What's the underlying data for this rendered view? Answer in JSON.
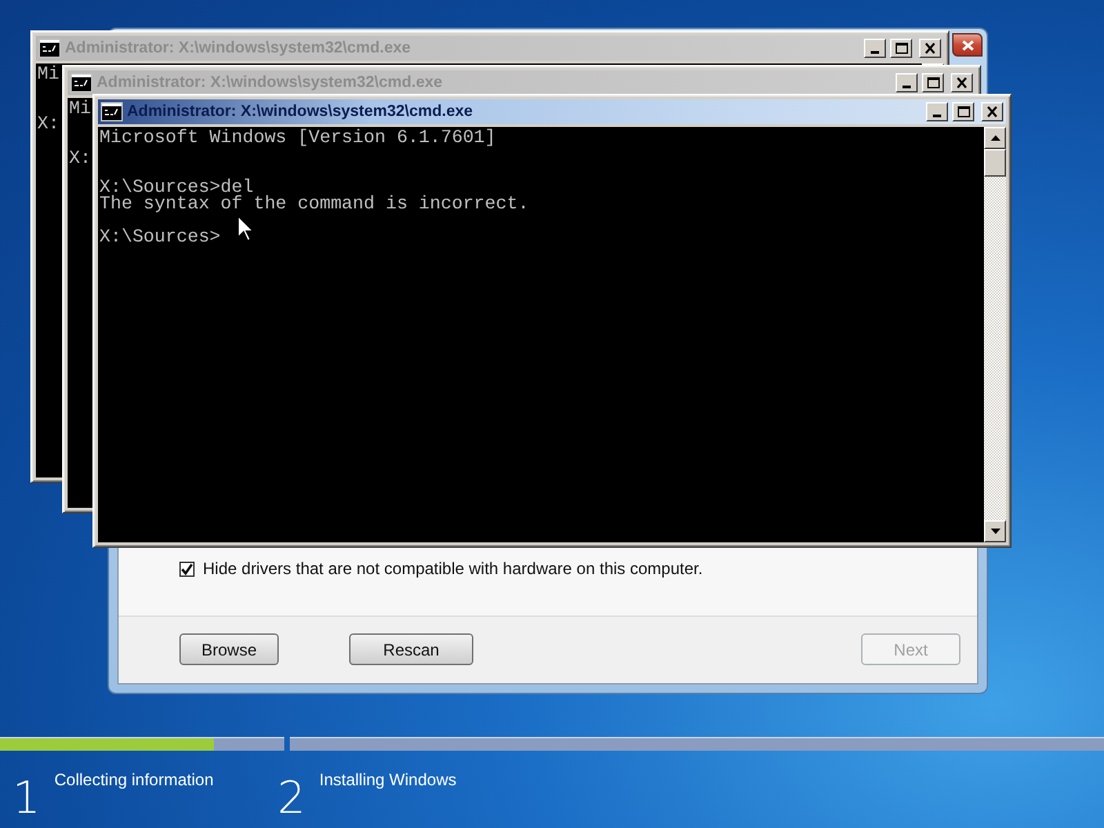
{
  "setup_dialog": {
    "checkbox": {
      "label": "Hide drivers that are not compatible with hardware on this computer.",
      "checked": true
    },
    "buttons": [
      {
        "label": "Browse",
        "disabled": false
      },
      {
        "label": "Rescan",
        "disabled": false
      },
      {
        "label": "Next",
        "disabled": true
      }
    ]
  },
  "cmd_windows": [
    {
      "title": "Administrator: X:\\windows\\system32\\cmd.exe",
      "active": false,
      "blocks": [
        [
          "Mi"
        ],
        [
          "X:"
        ]
      ]
    },
    {
      "title": "Administrator: X:\\windows\\system32\\cmd.exe",
      "active": false,
      "blocks": [
        [
          "Mi"
        ],
        [
          "X:"
        ]
      ]
    },
    {
      "title": "Administrator: X:\\windows\\system32\\cmd.exe",
      "active": true,
      "blocks": [
        [
          "Microsoft Windows [Version 6.1.7601]"
        ],
        [
          "X:\\Sources>del",
          "The syntax of the command is incorrect."
        ],
        [
          "X:\\Sources>"
        ]
      ]
    }
  ],
  "progress": {
    "steps": [
      {
        "number": "1",
        "label": "Collecting information",
        "level": 0.75
      },
      {
        "number": "2",
        "label": "Installing Windows"
      }
    ]
  }
}
